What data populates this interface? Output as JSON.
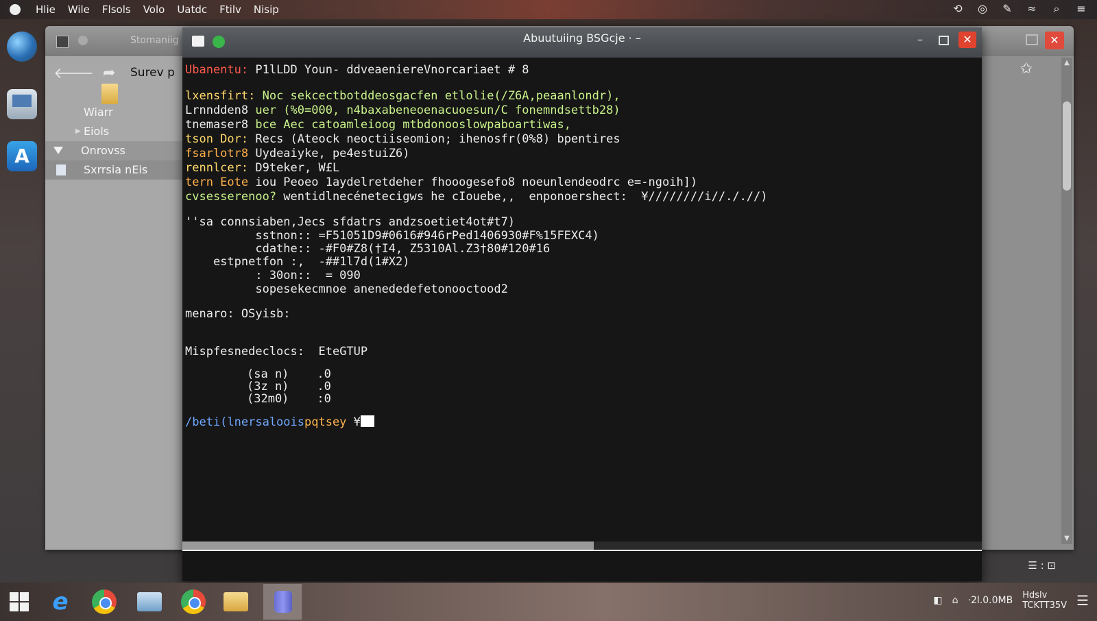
{
  "menubar": {
    "items": [
      "Hlie",
      "Wile",
      "Flsols",
      "Volo",
      "Uatdc",
      "Ftilv",
      "Nisip"
    ],
    "right_icons": [
      "network-icon",
      "sync-icon",
      "edit-icon",
      "wifi-icon",
      "search-icon",
      "menu-icon"
    ]
  },
  "file_manager": {
    "title": "Stomaniig s",
    "location": "Surev  p",
    "tree": [
      {
        "label": "Wiarr"
      },
      {
        "label": "Eiols"
      },
      {
        "label": "Onrovss"
      },
      {
        "label": "Sxrrsia nEis"
      }
    ]
  },
  "terminal": {
    "title": "Abuutuiing BSGcje · –",
    "prompt_user": "Ubanentu:",
    "prompt_rest": " P1lLDD Youn- ddveaeniereVnorcariaet # 8",
    "lines": [
      {
        "key": "lxensfirt:",
        "val": " Noc sekcectbotddeosgacfen etlolie(/Z6A,peaanlondr),"
      },
      {
        "key": "Lrnndden8",
        "val": " uer (%0=000, n4baxabeneoenacuoesun/C fonemndsettb28)"
      },
      {
        "key": "tnemaser8",
        "val": " bce Aec catoamleioog mtbdonooslowpaboartiwas,"
      },
      {
        "key": "tson Dor:",
        "val": " Recs (Ateock neoctiiseomion; ihenosfr(0%8) bpentires"
      },
      {
        "key": "fsarlotr8",
        "val": " Uydeaiyke, pe4estuiZ6)"
      },
      {
        "key": "rennlcer:",
        "val": " D9teker, W£L"
      },
      {
        "key": "tern Eote",
        "val": " iou Peoeo 1aydelretdeher fhooogesefo8 noeunlendeodrc e=-ngoih])"
      },
      {
        "key": "cvsesserenoo?",
        "val": " wentidlnecénetecigws he cIouebe,,  enponoershect:  ¥////////i//././/)"
      }
    ],
    "block": [
      "''sa connsiaben,Jecs sfdatrs andzsoetiet4ot#t7)",
      "          sstnon:: =F51051D9#0616#946rPed1406930#F%15FEXC4)",
      "          cdathe:: -#F0#Z8(†I4, Z5310Al.Z3†80#120#16",
      "    estpnetfon :,  -##1l7d(1#X2)",
      "          : 30on::  = 090",
      "          sopesekecmnoe anenededefetonooctood2"
    ],
    "menaro": "menaro: OSyisb:",
    "misp_label": "Mispfesnedeclocs:",
    "misp_value": "EteGTUP",
    "table": [
      {
        "a": "(sa n)",
        "b": ".0"
      },
      {
        "a": "(3z n)",
        "b": ".0"
      },
      {
        "a": "(32m0)",
        "b": ":0"
      }
    ],
    "final_path": "/beti(lnersaloois",
    "final_branch": "pqtsey",
    "final_marker": " ¥"
  },
  "taskbar": {
    "apps": [
      "start-icon",
      "ie-icon",
      "chrome-icon",
      "files-icon",
      "chrome-icon",
      "folder-icon",
      "app-icon"
    ],
    "tray": {
      "net": "·2l.0.0MB",
      "clock_top": "Hdslv",
      "clock_bottom": "TCKTT35V"
    }
  },
  "status_icon_text": "☰ : ⊡"
}
